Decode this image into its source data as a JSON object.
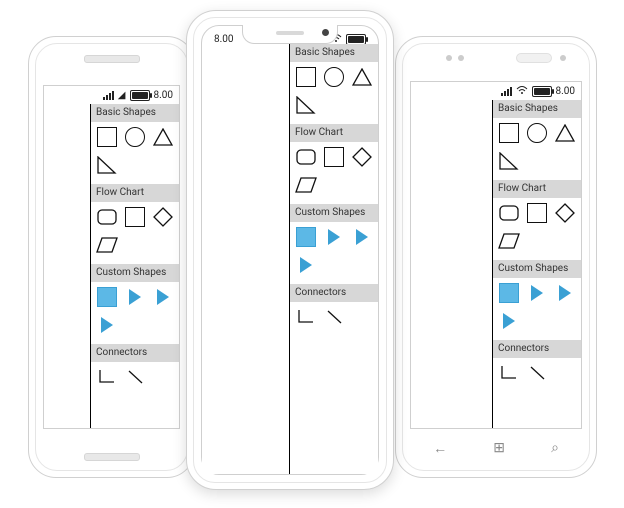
{
  "status": {
    "time": "8.00"
  },
  "groups": {
    "basic": {
      "title": "Basic Shapes"
    },
    "flow": {
      "title": "Flow Chart"
    },
    "custom": {
      "title": "Custom Shapes"
    },
    "conn": {
      "title": "Connectors"
    }
  },
  "nav": {
    "back": "←",
    "win": "⊞",
    "search": "⌕"
  }
}
